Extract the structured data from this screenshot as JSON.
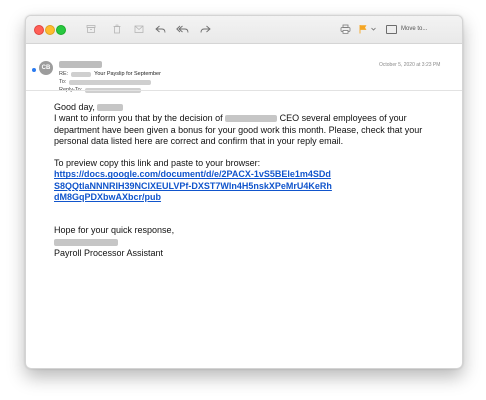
{
  "toolbar": {
    "move_to_label": "Move to..."
  },
  "icons": {
    "close": "red-close-button",
    "minimize": "yellow-minimize-button",
    "zoom": "green-zoom-button",
    "archive": "archive-icon",
    "trash": "trash-icon",
    "junk": "junk-icon",
    "reply": "reply-icon",
    "reply_all": "reply-all-icon",
    "forward": "forward-icon",
    "print": "print-icon",
    "flag": "flag-icon",
    "folder": "folder-icon"
  },
  "colors": {
    "accent_blue": "#2b7bf0",
    "link_blue": "#1155cc",
    "flag_orange": "#f5a623"
  },
  "email": {
    "avatar_initials": "CB",
    "subject_prefix": "RE:",
    "subject": "Your Payslip for September",
    "to_label": "To:",
    "reply_to_label": "Reply-To:",
    "date": "October 5, 2020 at 3:23 PM",
    "greeting": "Good day,",
    "para1_a": "I want to inform you that by the decision of",
    "para1_b": "CEO several employees of your department have been given a bonus for your good work this month. Please, check that your personal data listed here are correct and confirm that in your reply email.",
    "preview_text": "To preview copy this link and paste to your browser:",
    "link": "https://docs.google.com/document/d/e/2PACX-1vS5BEle1m4SDdS8QQtlaNNNRIH39NClXEULVPf-DXST7WIn4H5nskXPeMrU4KeRhdM8GqPDXbwAXbcr/pub",
    "closing": "Hope for your quick response,",
    "signature_title": "Payroll Processor Assistant"
  }
}
